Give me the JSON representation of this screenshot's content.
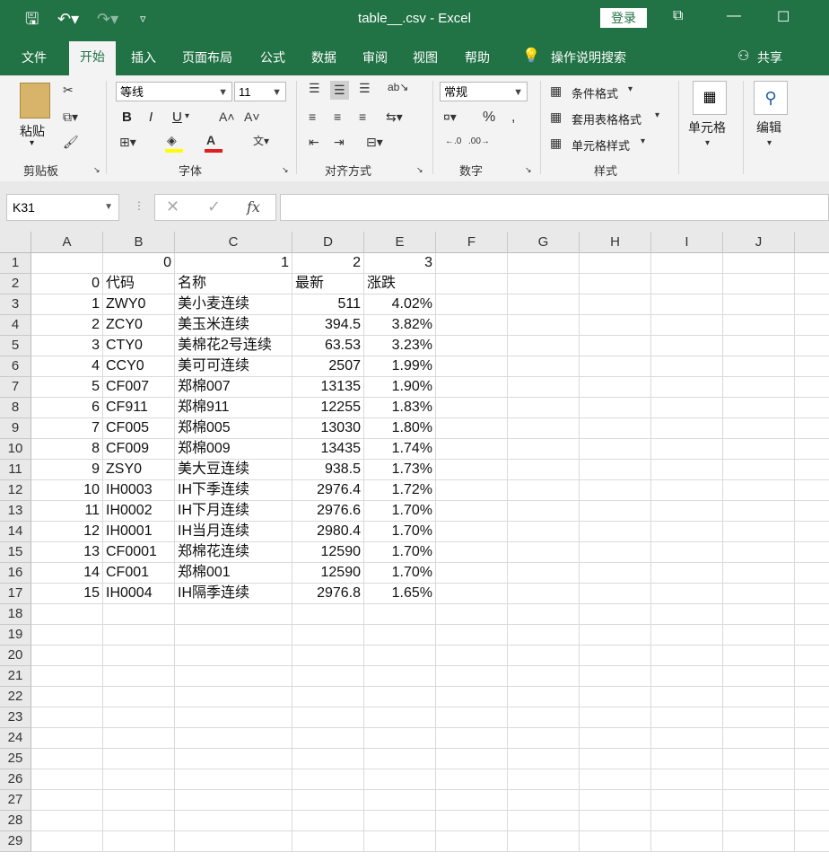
{
  "titlebar": {
    "title": "table__.csv  -  Excel",
    "login": "登录"
  },
  "tabs": [
    "文件",
    "开始",
    "插入",
    "页面布局",
    "公式",
    "数据",
    "审阅",
    "视图",
    "帮助",
    "操作说明搜索",
    "共享"
  ],
  "ribbon": {
    "paste": "粘贴",
    "clipboard_label": "剪贴板",
    "font_name": "等线",
    "font_size": "11",
    "font_label": "字体",
    "bold": "B",
    "italic": "I",
    "underline": "U",
    "align_label": "对齐方式",
    "number_format": "常规",
    "number_label": "数字",
    "cond_format": "条件格式",
    "table_format": "套用表格格式",
    "cell_style": "单元格样式",
    "styles_label": "样式",
    "cells": "单元格",
    "editing": "编辑"
  },
  "namebox": "K31",
  "columns": [
    "A",
    "B",
    "C",
    "D",
    "E",
    "F",
    "G",
    "H",
    "I",
    "J"
  ],
  "rows": [
    [
      "",
      "0",
      "1",
      "2",
      "3"
    ],
    [
      "0",
      "代码",
      "名称",
      "最新",
      "涨跌"
    ],
    [
      "1",
      "ZWY0",
      "美小麦连续",
      "511",
      "4.02%"
    ],
    [
      "2",
      "ZCY0",
      "美玉米连续",
      "394.5",
      "3.82%"
    ],
    [
      "3",
      "CTY0",
      "美棉花2号连续",
      "63.53",
      "3.23%"
    ],
    [
      "4",
      "CCY0",
      "美可可连续",
      "2507",
      "1.99%"
    ],
    [
      "5",
      "CF007",
      "郑棉007",
      "13135",
      "1.90%"
    ],
    [
      "6",
      "CF911",
      "郑棉911",
      "12255",
      "1.83%"
    ],
    [
      "7",
      "CF005",
      "郑棉005",
      "13030",
      "1.80%"
    ],
    [
      "8",
      "CF009",
      "郑棉009",
      "13435",
      "1.74%"
    ],
    [
      "9",
      "ZSY0",
      "美大豆连续",
      "938.5",
      "1.73%"
    ],
    [
      "10",
      "IH0003",
      "IH下季连续",
      "2976.4",
      "1.72%"
    ],
    [
      "11",
      "IH0002",
      "IH下月连续",
      "2976.6",
      "1.70%"
    ],
    [
      "12",
      "IH0001",
      "IH当月连续",
      "2980.4",
      "1.70%"
    ],
    [
      "13",
      "CF0001",
      "郑棉花连续",
      "12590",
      "1.70%"
    ],
    [
      "14",
      "CF001",
      "郑棉001",
      "12590",
      "1.70%"
    ],
    [
      "15",
      "IH0004",
      "IH隔季连续",
      "2976.8",
      "1.65%"
    ]
  ],
  "row_count": 29
}
